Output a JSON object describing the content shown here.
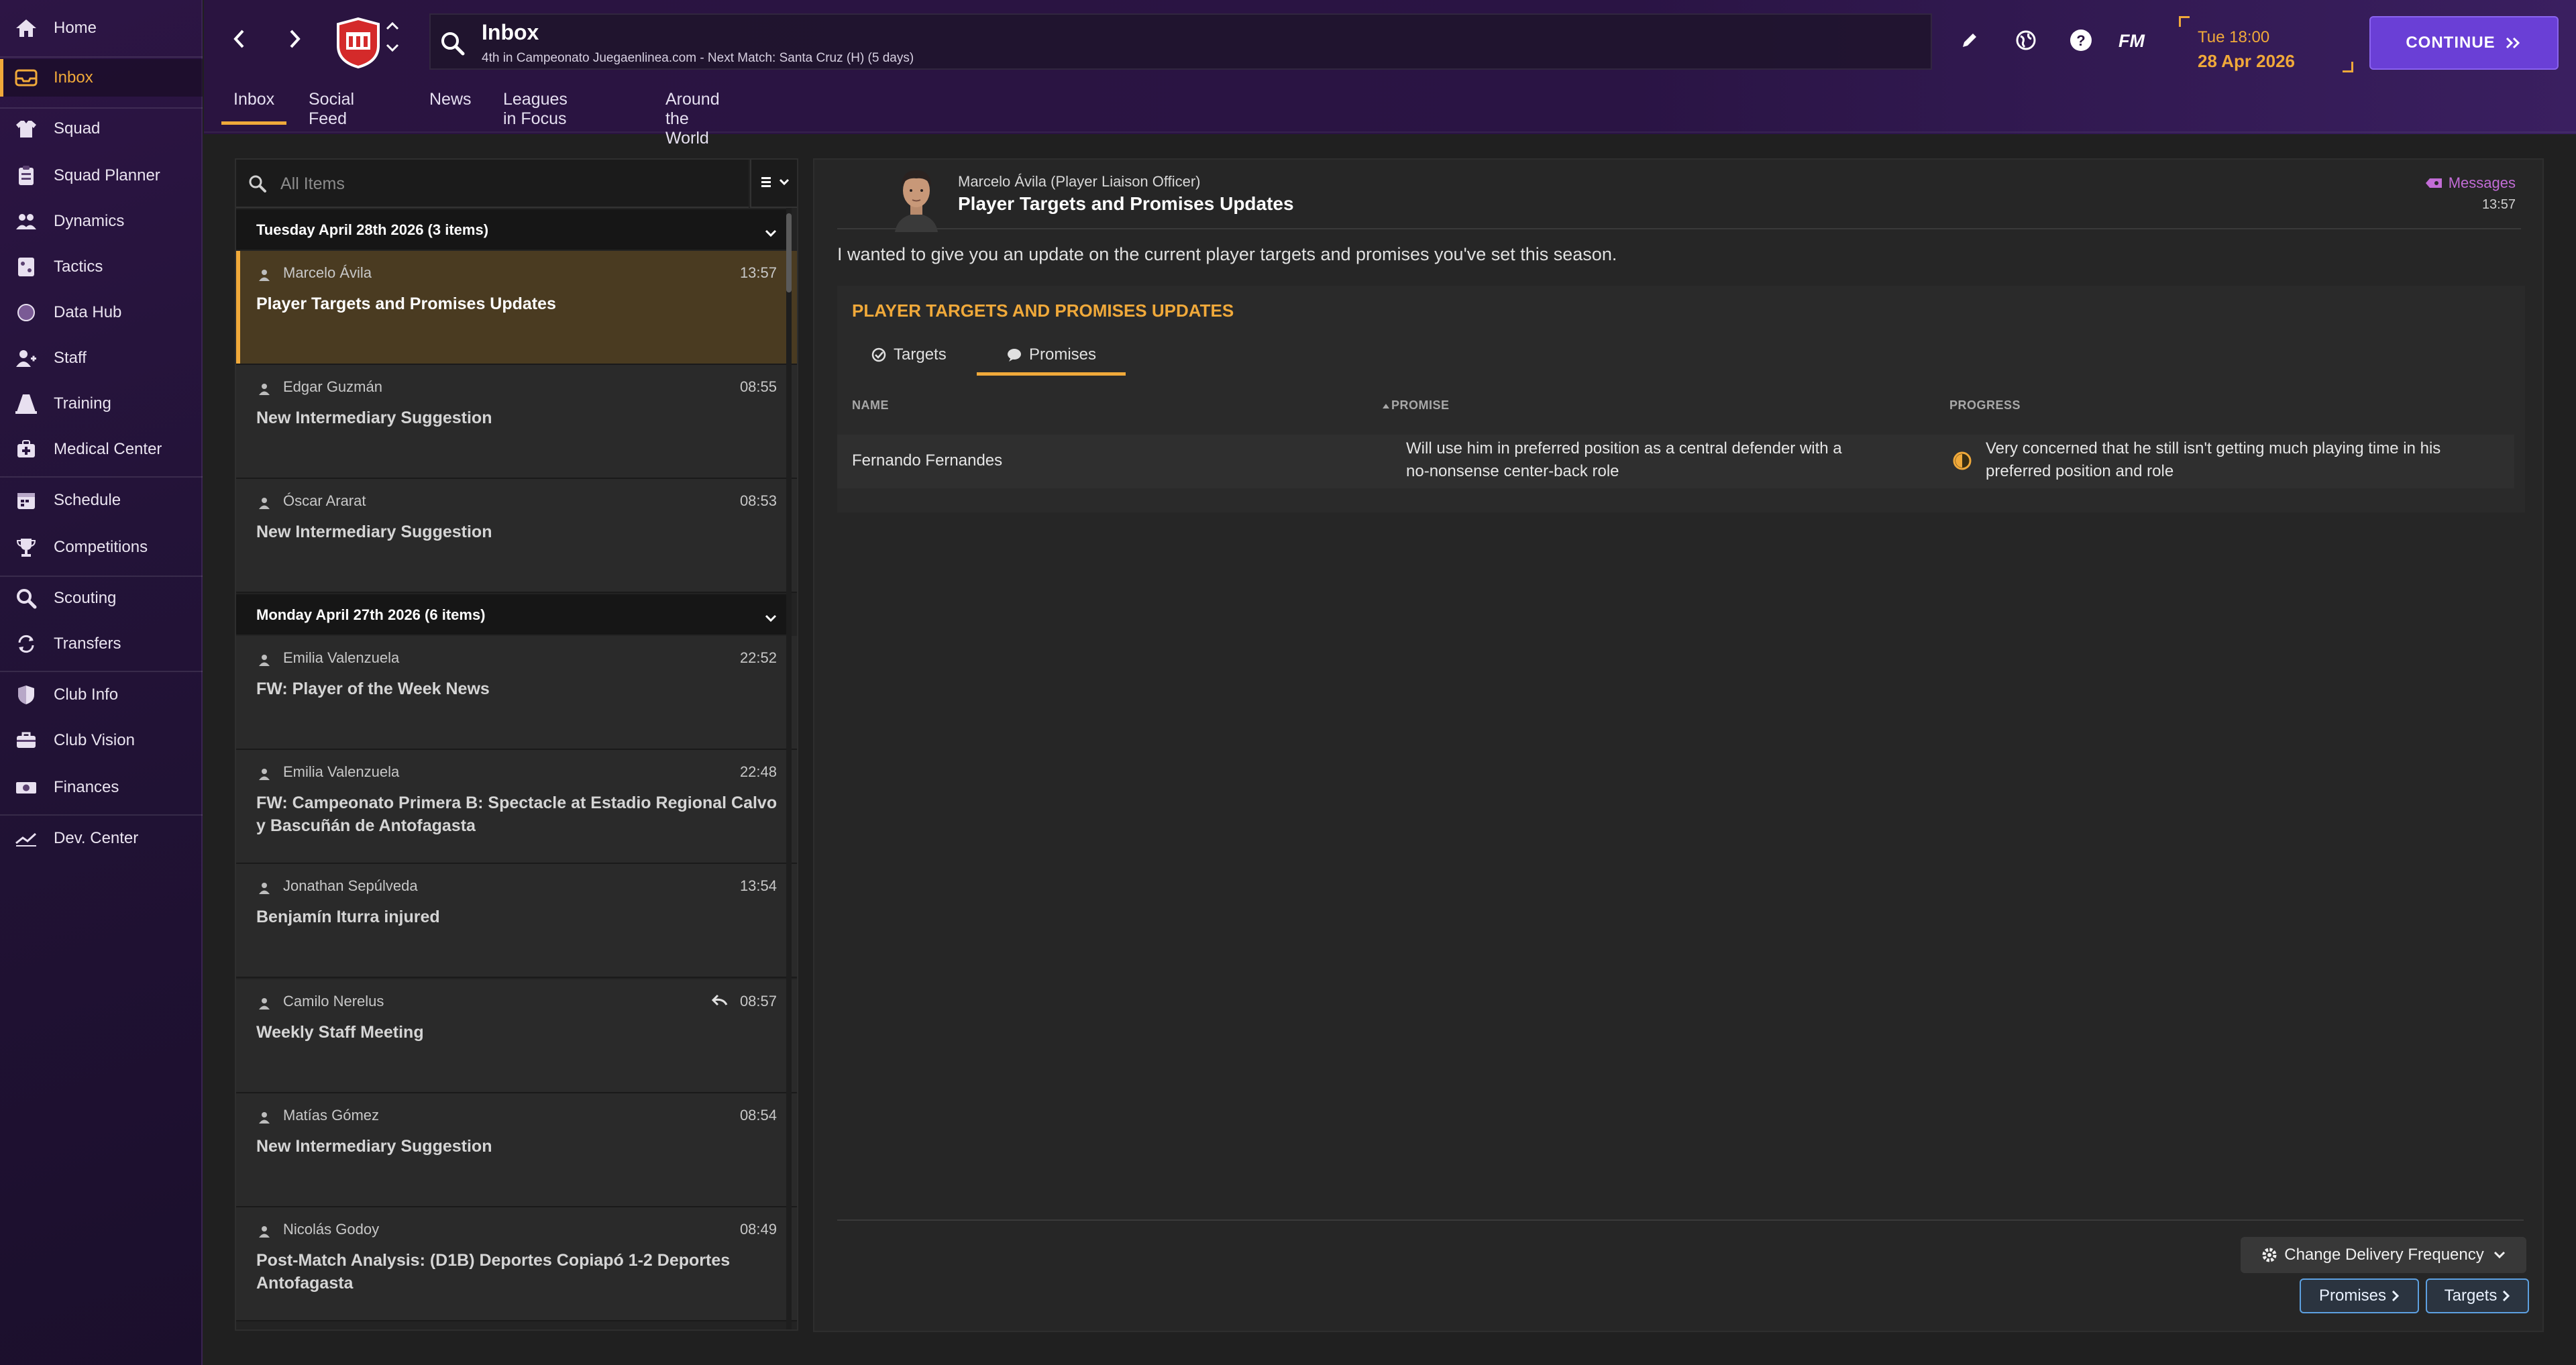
{
  "colors": {
    "accent": "#f0a93a",
    "continue": "#6a3fd6",
    "messages_tag": "#c26cd6",
    "link_border": "#5da0e0"
  },
  "sidebar": {
    "items": [
      {
        "label": "Home",
        "icon": "home-icon"
      },
      {
        "label": "Inbox",
        "icon": "inbox-icon",
        "active": true
      },
      {
        "label": "Squad",
        "icon": "shirt-icon"
      },
      {
        "label": "Squad Planner",
        "icon": "clipboard-icon"
      },
      {
        "label": "Dynamics",
        "icon": "people-icon"
      },
      {
        "label": "Tactics",
        "icon": "tactics-board-icon"
      },
      {
        "label": "Data Hub",
        "icon": "data-globe-icon"
      },
      {
        "label": "Staff",
        "icon": "staff-icon"
      },
      {
        "label": "Training",
        "icon": "cone-icon"
      },
      {
        "label": "Medical Center",
        "icon": "medical-kit-icon"
      },
      {
        "label": "Schedule",
        "icon": "calendar-icon"
      },
      {
        "label": "Competitions",
        "icon": "trophy-icon"
      },
      {
        "label": "Scouting",
        "icon": "magnifier-icon"
      },
      {
        "label": "Transfers",
        "icon": "transfer-arrows-icon"
      },
      {
        "label": "Club Info",
        "icon": "shield-icon"
      },
      {
        "label": "Club Vision",
        "icon": "vision-icon"
      },
      {
        "label": "Finances",
        "icon": "money-icon"
      },
      {
        "label": "Dev. Center",
        "icon": "trend-icon"
      }
    ]
  },
  "header": {
    "title": "Inbox",
    "subtitle": "4th in Campeonato Juegaenlinea.com - Next Match: Santa Cruz (H) (5 days)",
    "fm_label": "FM",
    "time": "Tue 18:00",
    "date": "28 Apr 2026",
    "continue_label": "CONTINUE",
    "tabs": [
      "Inbox",
      "Social Feed",
      "News",
      "Leagues in Focus",
      "Around the World"
    ]
  },
  "inbox": {
    "search_placeholder": "All Items",
    "groups": [
      {
        "header": "Tuesday April 28th 2026 (3 items)",
        "messages": [
          {
            "sender": "Marcelo Ávila",
            "time": "13:57",
            "subject": "Player Targets and Promises Updates",
            "selected": true
          },
          {
            "sender": "Edgar Guzmán",
            "time": "08:55",
            "subject": "New Intermediary Suggestion"
          },
          {
            "sender": "Óscar Ararat",
            "time": "08:53",
            "subject": "New Intermediary Suggestion"
          }
        ]
      },
      {
        "header": "Monday April 27th 2026 (6 items)",
        "messages": [
          {
            "sender": "Emilia Valenzuela",
            "time": "22:52",
            "subject": "FW: Player of the Week News"
          },
          {
            "sender": "Emilia Valenzuela",
            "time": "22:48",
            "subject": "FW: Campeonato Primera B: Spectacle at Estadio Regional Calvo y Bascuñán de Antofagasta"
          },
          {
            "sender": "Jonathan Sepúlveda",
            "time": "13:54",
            "subject": "Benjamín Iturra injured"
          },
          {
            "sender": "Camilo Nerelus",
            "time": "08:57",
            "subject": "Weekly Staff Meeting",
            "replied": true
          },
          {
            "sender": "Matías Gómez",
            "time": "08:54",
            "subject": "New Intermediary Suggestion"
          },
          {
            "sender": "Nicolás Godoy",
            "time": "08:49",
            "subject": "Post-Match Analysis: (D1B) Deportes Copiapó 1-2 Deportes Antofagasta"
          }
        ]
      }
    ]
  },
  "message": {
    "sender": "Marcelo Ávila  (Player Liaison Officer)",
    "subject": "Player Targets and Promises Updates",
    "category": "Messages",
    "time": "13:57",
    "body": "I wanted to give you an update on the current player targets and promises you've set this season.",
    "card_title": "PLAYER TARGETS AND PROMISES UPDATES",
    "tabs": [
      "Targets",
      "Promises"
    ],
    "active_tab": "Promises",
    "columns": [
      "NAME",
      "PROMISE",
      "PROGRESS"
    ],
    "rows": [
      {
        "name": "Fernando Fernandes",
        "promise_line1": "Will use him in preferred position as a central defender with a",
        "promise_line2": "no-nonsense center-back role",
        "progress_line1": "Very concerned that he still isn't getting much playing time in his",
        "progress_line2": "preferred position and role"
      }
    ],
    "delivery_label": "Change Delivery Frequency",
    "promises_btn": "Promises",
    "targets_btn": "Targets"
  }
}
